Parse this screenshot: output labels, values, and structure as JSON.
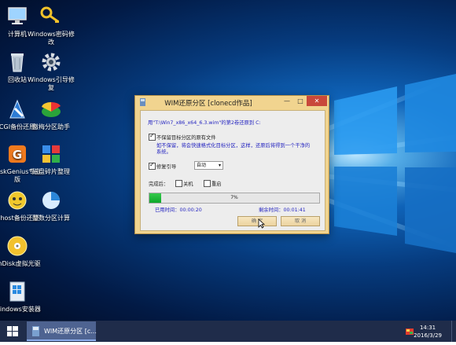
{
  "desktop_icons": [
    {
      "label": "计算机",
      "icon": "computer-icon"
    },
    {
      "label": "Windows密码修改",
      "icon": "key-icon"
    },
    {
      "label": "回收站",
      "icon": "recycle-bin-icon"
    },
    {
      "label": "Windows引导修复",
      "icon": "gear-icon"
    },
    {
      "label": "CGI备份还原",
      "icon": "cgi-icon"
    },
    {
      "label": "傲梅分区助手",
      "icon": "partition-assistant-icon"
    },
    {
      "label": "DiskGenius专业版",
      "icon": "diskgenius-icon"
    },
    {
      "label": "磁盘碎片整理",
      "icon": "defrag-icon"
    },
    {
      "label": "Ghost备份还原",
      "icon": "ghost-icon"
    },
    {
      "label": "整数分区计算",
      "icon": "pie-icon"
    },
    {
      "label": "ImDisk虚拟光驱",
      "icon": "disc-icon"
    },
    {
      "label": "Windows安装器",
      "icon": "installer-icon"
    }
  ],
  "dialog": {
    "title": "WIM还原分区 [clonecd作品]",
    "minimize": "—",
    "maximize": "□",
    "close": "✕",
    "info_line": "用\"T:\\Win7_x86_x64_6.3.wim\"的第2卷还原到 C:",
    "keep_files": {
      "label": "不保留目标分区的原有文件",
      "checked": true
    },
    "keep_files_note_1": "如不保留，将会快速格式化目标分区，这样，还原后将得到一个干净的",
    "keep_files_note_2": "系统。",
    "repair_boot": {
      "label": "修复引导",
      "checked": true
    },
    "boot_mode_value": "自动",
    "on_complete_label": "完成后：",
    "shutdown": {
      "label": "关机",
      "checked": false
    },
    "restart": {
      "label": "重启",
      "checked": false
    },
    "progress_percent": 7,
    "progress_text": "7%",
    "elapsed": "已用时间：00:00:20",
    "remaining": "剩余时间：00:01:41",
    "ok_label": "确 定",
    "cancel_label": "取 消"
  },
  "taskbar": {
    "task_label": "WIM还原分区 [c...",
    "time": "14:31",
    "date": "2016/3/29"
  }
}
